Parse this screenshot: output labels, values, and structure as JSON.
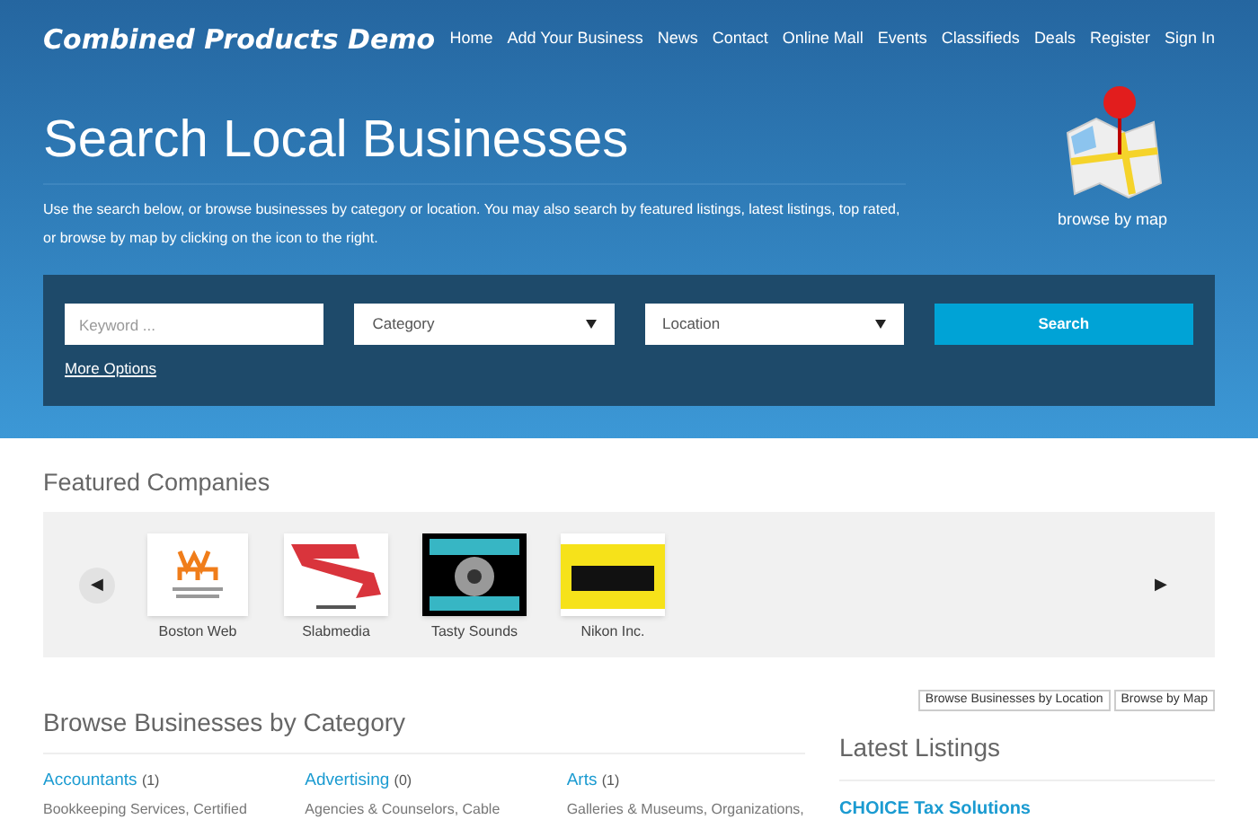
{
  "site_title": "Combined Products Demo",
  "nav": [
    "Home",
    "Add Your Business",
    "News",
    "Contact",
    "Online Mall",
    "Events",
    "Classifieds",
    "Deals",
    "Register",
    "Sign In"
  ],
  "hero": {
    "title": "Search Local Businesses",
    "text": "Use the search below, or browse businesses by category or location. You may also search by featured listings, latest listings, top rated, or browse by map by clicking on the icon to the right.",
    "map_label": "browse by map"
  },
  "search": {
    "keyword_placeholder": "Keyword ...",
    "category": "Category",
    "location": "Location",
    "button": "Search",
    "more": "More Options"
  },
  "featured": {
    "title": "Featured Companies",
    "prev": "◀",
    "next": "▶",
    "companies": [
      {
        "name": "Boston Web",
        "kind": "boston"
      },
      {
        "name": "Slabmedia",
        "kind": "slab"
      },
      {
        "name": "Tasty Sounds",
        "kind": "tasty"
      },
      {
        "name": "Nikon Inc.",
        "kind": "nikon"
      }
    ]
  },
  "browse_buttons": [
    "Browse Businesses by Location",
    "Browse by Map"
  ],
  "categories": {
    "title": "Browse Businesses by Category",
    "items": [
      {
        "name": "Accountants",
        "count": "(1)",
        "lines": [
          "Bookkeeping Services, Certified"
        ]
      },
      {
        "name": "Advertising",
        "count": "(0)",
        "lines": [
          "Agencies & Counselors, Cable"
        ]
      },
      {
        "name": "Arts",
        "count": "(1)",
        "lines": [
          "Galleries & Museums, Organizations,"
        ]
      }
    ]
  },
  "latest": {
    "title": "Latest Listings",
    "items": [
      {
        "name": "CHOICE Tax Solutions"
      }
    ]
  }
}
